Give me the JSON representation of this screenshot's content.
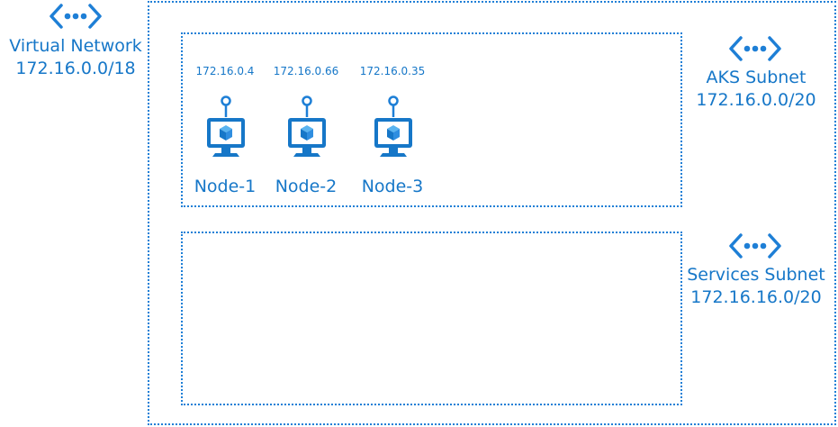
{
  "virtual_network": {
    "title": "Virtual Network",
    "cidr": "172.16.0.0/18",
    "icon": "virtual-network-icon"
  },
  "subnets": [
    {
      "name": "AKS Subnet",
      "cidr": "172.16.0.0/20",
      "icon": "subnet-icon"
    },
    {
      "name": "Services Subnet",
      "cidr": "172.16.16.0/20",
      "icon": "subnet-icon"
    }
  ],
  "nodes": [
    {
      "name": "Node-1",
      "ip": "172.16.0.4",
      "icon": "virtual-machine-icon"
    },
    {
      "name": "Node-2",
      "ip": "172.16.0.66",
      "icon": "virtual-machine-icon"
    },
    {
      "name": "Node-3",
      "ip": "172.16.0.35",
      "icon": "virtual-machine-icon"
    }
  ],
  "colors": {
    "accent": "#1677c8",
    "border": "#1e7fd6",
    "icon_light": "#5ab4f0"
  }
}
